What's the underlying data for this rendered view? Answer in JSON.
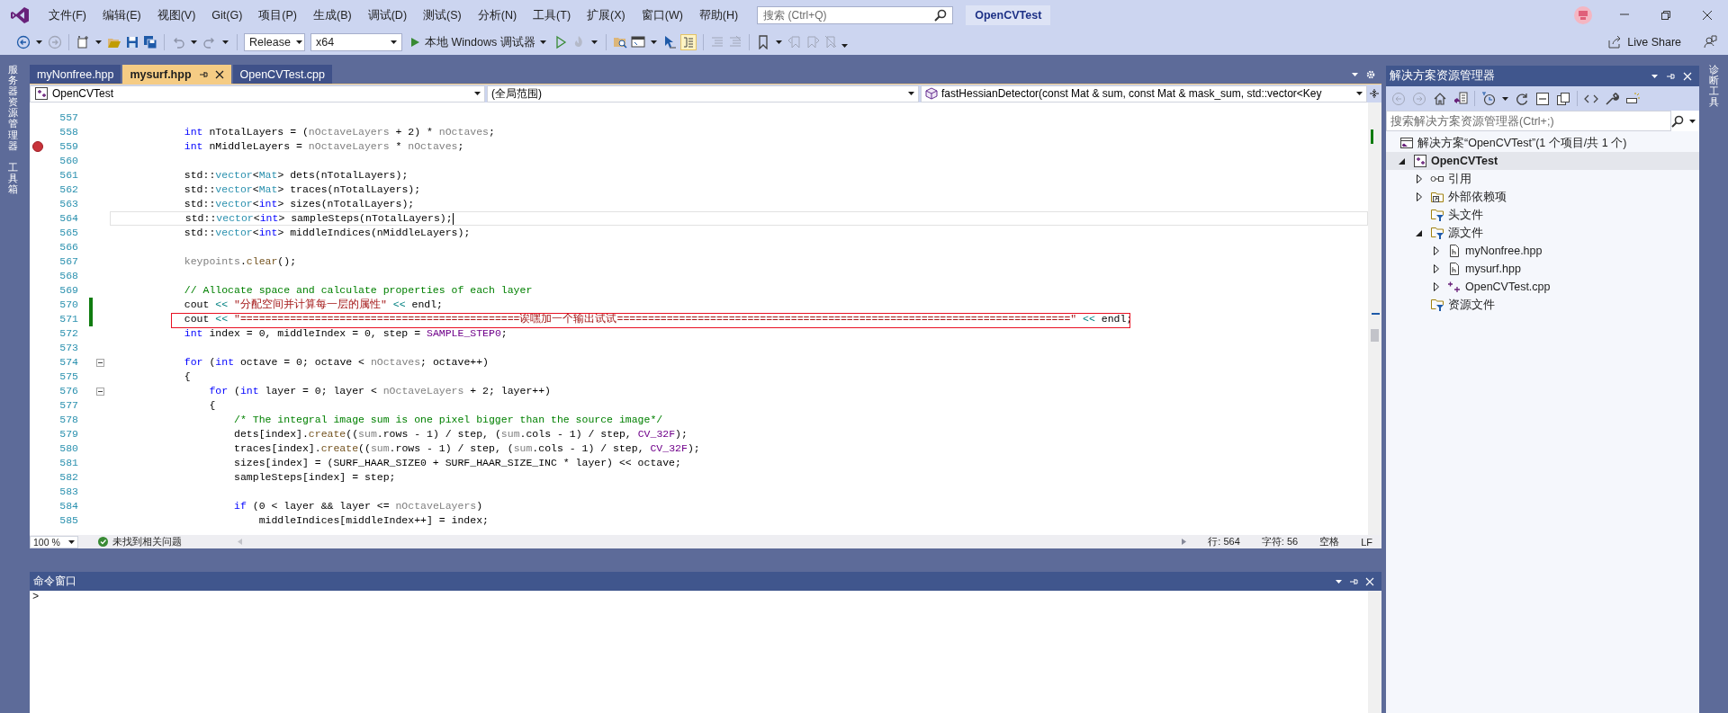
{
  "menu": [
    "文件(F)",
    "编辑(E)",
    "视图(V)",
    "Git(G)",
    "项目(P)",
    "生成(B)",
    "调试(D)",
    "测试(S)",
    "分析(N)",
    "工具(T)",
    "扩展(X)",
    "窗口(W)",
    "帮助(H)"
  ],
  "title_search": {
    "placeholder": "搜索 (Ctrl+Q)"
  },
  "solution_name": "OpenCVTest",
  "toolbar": {
    "configuration": "Release",
    "platform": "x64",
    "debug_button": "本地 Windows 调试器",
    "live_share": "Live Share"
  },
  "left_strip": [
    "服务器资源管理器",
    "工具箱"
  ],
  "right_strip": [
    "诊断工具"
  ],
  "tabs": [
    {
      "label": "myNonfree.hpp",
      "selected": false
    },
    {
      "label": "mysurf.hpp",
      "selected": true
    },
    {
      "label": "OpenCVTest.cpp",
      "selected": false
    }
  ],
  "nav": {
    "project": "OpenCVTest",
    "scope": "(全局范围)",
    "member": "fastHessianDetector(const Mat & sum, const Mat & mask_sum, std::vector<Key"
  },
  "code": [
    {
      "number": "557",
      "breakpoint": false,
      "edited": false,
      "current": false,
      "fold": false,
      "boxed": false
    },
    {
      "number": "558",
      "breakpoint": false,
      "edited": false,
      "current": false,
      "fold": false,
      "boxed": false,
      "tokens": [
        {
          "kind": "kw",
          "text": "            int"
        },
        {
          "kind": "plain",
          "text": " nTotalLayers = ("
        },
        {
          "kind": "param",
          "text": "nOctaveLayers"
        },
        {
          "kind": "plain",
          "text": " + 2) * "
        },
        {
          "kind": "param",
          "text": "nOctaves"
        },
        {
          "kind": "plain",
          "text": ";"
        }
      ]
    },
    {
      "number": "559",
      "breakpoint": true,
      "edited": false,
      "current": false,
      "fold": false,
      "boxed": false,
      "tokens": [
        {
          "kind": "kw",
          "text": "            int"
        },
        {
          "kind": "plain",
          "text": " nMiddleLayers = "
        },
        {
          "kind": "param",
          "text": "nOctaveLayers"
        },
        {
          "kind": "plain",
          "text": " * "
        },
        {
          "kind": "param",
          "text": "nOctaves"
        },
        {
          "kind": "plain",
          "text": ";"
        }
      ]
    },
    {
      "number": "560",
      "breakpoint": false,
      "edited": false,
      "current": false,
      "fold": false,
      "boxed": false
    },
    {
      "number": "561",
      "breakpoint": false,
      "edited": false,
      "current": false,
      "fold": false,
      "boxed": false,
      "tokens": [
        {
          "kind": "plain",
          "text": "            std::"
        },
        {
          "kind": "type",
          "text": "vector"
        },
        {
          "kind": "plain",
          "text": "<"
        },
        {
          "kind": "type",
          "text": "Mat"
        },
        {
          "kind": "plain",
          "text": "> dets(nTotalLayers);"
        }
      ]
    },
    {
      "number": "562",
      "breakpoint": false,
      "edited": false,
      "current": false,
      "fold": false,
      "boxed": false,
      "tokens": [
        {
          "kind": "plain",
          "text": "            std::"
        },
        {
          "kind": "type",
          "text": "vector"
        },
        {
          "kind": "plain",
          "text": "<"
        },
        {
          "kind": "type",
          "text": "Mat"
        },
        {
          "kind": "plain",
          "text": "> traces(nTotalLayers);"
        }
      ]
    },
    {
      "number": "563",
      "breakpoint": false,
      "edited": false,
      "current": false,
      "fold": false,
      "boxed": false,
      "tokens": [
        {
          "kind": "plain",
          "text": "            std::"
        },
        {
          "kind": "type",
          "text": "vector"
        },
        {
          "kind": "plain",
          "text": "<"
        },
        {
          "kind": "kw",
          "text": "int"
        },
        {
          "kind": "plain",
          "text": "> sizes(nTotalLayers);"
        }
      ]
    },
    {
      "number": "564",
      "breakpoint": false,
      "edited": false,
      "current": true,
      "fold": false,
      "boxed": false,
      "tokens": [
        {
          "kind": "plain",
          "text": "            std::"
        },
        {
          "kind": "type",
          "text": "vector"
        },
        {
          "kind": "plain",
          "text": "<"
        },
        {
          "kind": "kw",
          "text": "int"
        },
        {
          "kind": "plain",
          "text": "> sampleSteps(nTotalLayers);"
        }
      ]
    },
    {
      "number": "565",
      "breakpoint": false,
      "edited": false,
      "current": false,
      "fold": false,
      "boxed": false,
      "tokens": [
        {
          "kind": "plain",
          "text": "            std::"
        },
        {
          "kind": "type",
          "text": "vector"
        },
        {
          "kind": "plain",
          "text": "<"
        },
        {
          "kind": "kw",
          "text": "int"
        },
        {
          "kind": "plain",
          "text": "> middleIndices(nMiddleLayers);"
        }
      ]
    },
    {
      "number": "566",
      "breakpoint": false,
      "edited": false,
      "current": false,
      "fold": false,
      "boxed": false
    },
    {
      "number": "567",
      "breakpoint": false,
      "edited": false,
      "current": false,
      "fold": false,
      "boxed": false,
      "tokens": [
        {
          "kind": "param",
          "text": "            keypoints"
        },
        {
          "kind": "plain",
          "text": "."
        },
        {
          "kind": "func",
          "text": "clear"
        },
        {
          "kind": "plain",
          "text": "();"
        }
      ]
    },
    {
      "number": "568",
      "breakpoint": false,
      "edited": false,
      "current": false,
      "fold": false,
      "boxed": false
    },
    {
      "number": "569",
      "breakpoint": false,
      "edited": false,
      "current": false,
      "fold": false,
      "boxed": false,
      "tokens": [
        {
          "kind": "comment",
          "text": "            // Allocate space and calculate properties of each layer"
        }
      ]
    },
    {
      "number": "570",
      "breakpoint": false,
      "edited": true,
      "current": false,
      "fold": false,
      "boxed": false,
      "tokens": [
        {
          "kind": "plain",
          "text": "            cout "
        },
        {
          "kind": "op",
          "text": "<< "
        },
        {
          "kind": "string",
          "text": "\"分配空间并计算每一层的属性\""
        },
        {
          "kind": "op",
          "text": " <<"
        },
        {
          "kind": "plain",
          "text": " endl;"
        }
      ]
    },
    {
      "number": "571",
      "breakpoint": false,
      "edited": true,
      "current": false,
      "fold": false,
      "boxed": true,
      "tokens": [
        {
          "kind": "plain",
          "text": "            cout "
        },
        {
          "kind": "op",
          "text": "<< "
        },
        {
          "kind": "string",
          "text": "\"=============================================诶嘿加一个输出试试=========================================================================\""
        },
        {
          "kind": "op",
          "text": " <<"
        },
        {
          "kind": "plain",
          "text": " endl;"
        }
      ]
    },
    {
      "number": "572",
      "breakpoint": false,
      "edited": false,
      "current": false,
      "fold": false,
      "boxed": false,
      "tokens": [
        {
          "kind": "kw",
          "text": "            int"
        },
        {
          "kind": "plain",
          "text": " index = 0, middleIndex = 0, step = "
        },
        {
          "kind": "macro",
          "text": "SAMPLE_STEP0"
        },
        {
          "kind": "plain",
          "text": ";"
        }
      ]
    },
    {
      "number": "573",
      "breakpoint": false,
      "edited": false,
      "current": false,
      "fold": false,
      "boxed": false
    },
    {
      "number": "574",
      "breakpoint": false,
      "edited": false,
      "current": false,
      "fold": true,
      "boxed": false,
      "tokens": [
        {
          "kind": "kw",
          "text": "            for"
        },
        {
          "kind": "plain",
          "text": " ("
        },
        {
          "kind": "kw",
          "text": "int"
        },
        {
          "kind": "plain",
          "text": " octave = 0; octave < "
        },
        {
          "kind": "param",
          "text": "nOctaves"
        },
        {
          "kind": "plain",
          "text": "; octave++)"
        }
      ]
    },
    {
      "number": "575",
      "breakpoint": false,
      "edited": false,
      "current": false,
      "fold": false,
      "boxed": false,
      "tokens": [
        {
          "kind": "plain",
          "text": "            {"
        }
      ]
    },
    {
      "number": "576",
      "breakpoint": false,
      "edited": false,
      "current": false,
      "fold": true,
      "boxed": false,
      "tokens": [
        {
          "kind": "kw",
          "text": "                for"
        },
        {
          "kind": "plain",
          "text": " ("
        },
        {
          "kind": "kw",
          "text": "int"
        },
        {
          "kind": "plain",
          "text": " layer = 0; layer < "
        },
        {
          "kind": "param",
          "text": "nOctaveLayers"
        },
        {
          "kind": "plain",
          "text": " + 2; layer++)"
        }
      ]
    },
    {
      "number": "577",
      "breakpoint": false,
      "edited": false,
      "current": false,
      "fold": false,
      "boxed": false,
      "tokens": [
        {
          "kind": "plain",
          "text": "                {"
        }
      ]
    },
    {
      "number": "578",
      "breakpoint": false,
      "edited": false,
      "current": false,
      "fold": false,
      "boxed": false,
      "tokens": [
        {
          "kind": "comment",
          "text": "                    /* The integral image sum is one pixel bigger than the source image*/"
        }
      ]
    },
    {
      "number": "579",
      "breakpoint": false,
      "edited": false,
      "current": false,
      "fold": false,
      "boxed": false,
      "tokens": [
        {
          "kind": "plain",
          "text": "                    dets[index]."
        },
        {
          "kind": "func",
          "text": "create"
        },
        {
          "kind": "plain",
          "text": "(("
        },
        {
          "kind": "param",
          "text": "sum"
        },
        {
          "kind": "plain",
          "text": ".rows - 1) / step, ("
        },
        {
          "kind": "param",
          "text": "sum"
        },
        {
          "kind": "plain",
          "text": ".cols - 1) / step, "
        },
        {
          "kind": "macro",
          "text": "CV_32F"
        },
        {
          "kind": "plain",
          "text": ");"
        }
      ]
    },
    {
      "number": "580",
      "breakpoint": false,
      "edited": false,
      "current": false,
      "fold": false,
      "boxed": false,
      "tokens": [
        {
          "kind": "plain",
          "text": "                    traces[index]."
        },
        {
          "kind": "func",
          "text": "create"
        },
        {
          "kind": "plain",
          "text": "(("
        },
        {
          "kind": "param",
          "text": "sum"
        },
        {
          "kind": "plain",
          "text": ".rows - 1) / step, ("
        },
        {
          "kind": "param",
          "text": "sum"
        },
        {
          "kind": "plain",
          "text": ".cols - 1) / step, "
        },
        {
          "kind": "macro",
          "text": "CV_32F"
        },
        {
          "kind": "plain",
          "text": ");"
        }
      ]
    },
    {
      "number": "581",
      "breakpoint": false,
      "edited": false,
      "current": false,
      "fold": false,
      "boxed": false,
      "tokens": [
        {
          "kind": "plain",
          "text": "                    sizes[index] = (SURF_HAAR_SIZE0 + SURF_HAAR_SIZE_INC * layer) << octave;"
        }
      ]
    },
    {
      "number": "582",
      "breakpoint": false,
      "edited": false,
      "current": false,
      "fold": false,
      "boxed": false,
      "tokens": [
        {
          "kind": "plain",
          "text": "                    sampleSteps[index] = step;"
        }
      ]
    },
    {
      "number": "583",
      "breakpoint": false,
      "edited": false,
      "current": false,
      "fold": false,
      "boxed": false
    },
    {
      "number": "584",
      "breakpoint": false,
      "edited": false,
      "current": false,
      "fold": false,
      "boxed": false,
      "tokens": [
        {
          "kind": "kw",
          "text": "                    if"
        },
        {
          "kind": "plain",
          "text": " (0 < layer && layer <= "
        },
        {
          "kind": "param",
          "text": "nOctaveLayers"
        },
        {
          "kind": "plain",
          "text": ")"
        }
      ]
    },
    {
      "number": "585",
      "breakpoint": false,
      "edited": false,
      "current": false,
      "fold": false,
      "boxed": false,
      "tokens": [
        {
          "kind": "plain",
          "text": "                        middleIndices[middleIndex++] = index;"
        }
      ]
    }
  ],
  "status": {
    "zoom": "100 %",
    "issues": "未找到相关问题",
    "line": "行: 564",
    "char": "字符: 56",
    "spacing": "空格",
    "eol": "LF"
  },
  "command_window": {
    "title": "命令窗口",
    "prompt": ">"
  },
  "solution_explorer": {
    "title": "解决方案资源管理器",
    "search": {
      "placeholder": "搜索解决方案资源管理器(Ctrl+;)"
    },
    "tree": [
      {
        "label": "解决方案“OpenCVTest”(1 个项目/共 1 个)",
        "kind": "solution",
        "selected": false,
        "children": [
          {
            "label": "OpenCVTest",
            "kind": "project",
            "selected": true,
            "expanded": true,
            "children": [
              {
                "label": "引用",
                "kind": "reference",
                "selected": false,
                "expanded": false
              },
              {
                "label": "外部依赖项",
                "kind": "external",
                "selected": false,
                "expanded": false
              },
              {
                "label": "头文件",
                "kind": "filter",
                "selected": false
              },
              {
                "label": "源文件",
                "kind": "filter",
                "selected": false,
                "expanded": true,
                "children": [
                  {
                    "label": "myNonfree.hpp",
                    "kind": "header",
                    "selected": false,
                    "expanded": false
                  },
                  {
                    "label": "mysurf.hpp",
                    "kind": "header",
                    "selected": false,
                    "expanded": false
                  },
                  {
                    "label": "OpenCVTest.cpp",
                    "kind": "cpp",
                    "selected": false,
                    "expanded": false
                  }
                ]
              },
              {
                "label": "资源文件",
                "kind": "filter",
                "selected": false
              }
            ]
          }
        ]
      }
    ]
  }
}
